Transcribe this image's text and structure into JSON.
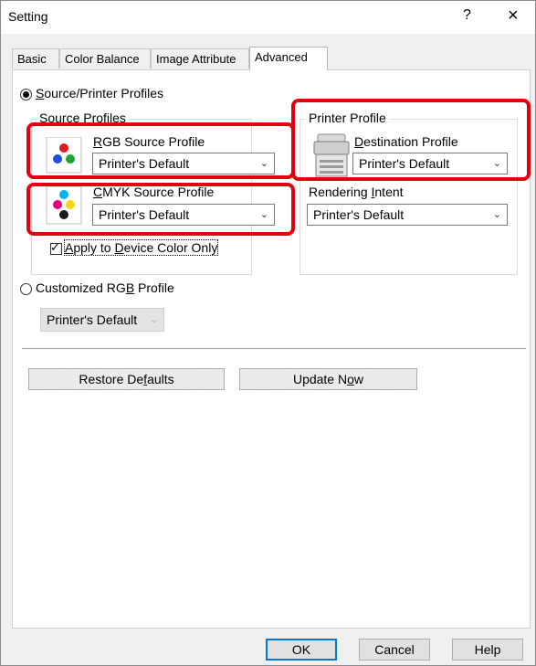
{
  "window": {
    "title": "Setting",
    "help_label": "?",
    "close_label": "×"
  },
  "tabs": [
    {
      "label": "Basic"
    },
    {
      "label": "Color Balance"
    },
    {
      "label": "Image Attribute"
    },
    {
      "label": "Advanced"
    }
  ],
  "source_printer": {
    "radio_prefix": "",
    "radio_u": "S",
    "radio_rest": "ource/Printer Profiles",
    "selected": true,
    "source_group": {
      "legend": "Source Profiles",
      "rgb": {
        "label_u": "R",
        "label_rest": "GB Source Profile",
        "value": "Printer's Default"
      },
      "cmyk": {
        "label_u": "C",
        "label_rest": "MYK Source Profile",
        "value": "Printer's Default"
      },
      "apply_device": {
        "label_u": "A",
        "label_rest": "pply to ",
        "label_u2": "D",
        "label_rest2": "evice Color Only",
        "checked": true
      }
    },
    "printer_group": {
      "legend": "Printer Profile",
      "destination": {
        "label_u": "D",
        "label_rest": "estination Profile",
        "value": "Printer's Default"
      },
      "rendering": {
        "label_pre": "Rendering ",
        "label_u": "I",
        "label_rest": "ntent",
        "value": "Printer's Default"
      }
    }
  },
  "customized": {
    "label_pre": "Customized RG",
    "label_u": "B",
    "label_rest": " Profile",
    "selected": false,
    "value": "Printer's Default"
  },
  "buttons": {
    "restore": {
      "pre": "Restore De",
      "u": "f",
      "rest": "aults"
    },
    "update": {
      "pre": "Update N",
      "u": "o",
      "rest": "w"
    }
  },
  "footer": {
    "ok": "OK",
    "cancel": "Cancel",
    "help": "Help"
  },
  "colors": {
    "highlight": "#e3000f",
    "focus": "#0078d7"
  }
}
